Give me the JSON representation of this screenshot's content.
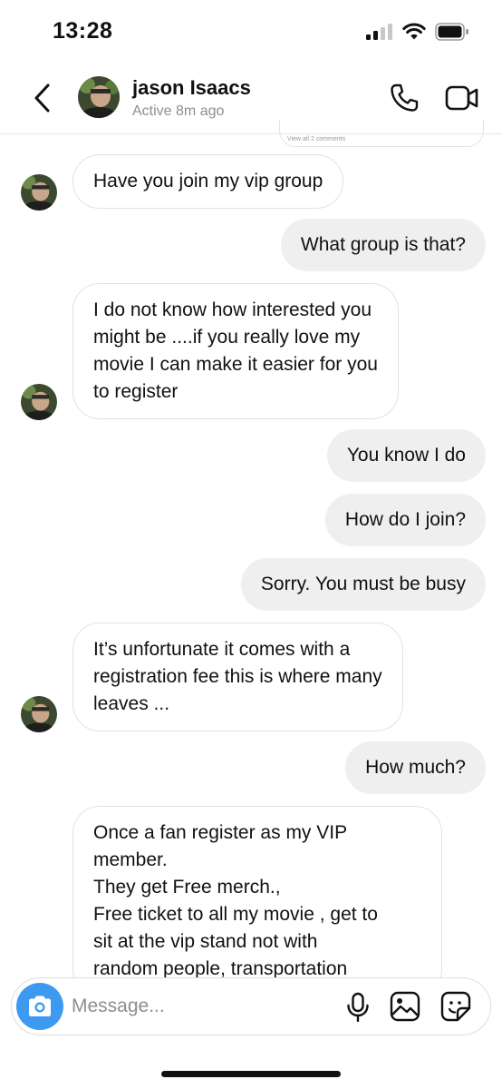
{
  "status_bar": {
    "time": "13:28"
  },
  "header": {
    "contact_name": "jason Isaacs",
    "contact_status": "Active 8m ago"
  },
  "shared_post": {
    "caption": "View all 2 comments"
  },
  "messages": [
    {
      "direction": "in",
      "lines": [
        "Have you join my vip group"
      ]
    },
    {
      "direction": "out",
      "lines": [
        "What group is that?"
      ]
    },
    {
      "direction": "in",
      "lines": [
        "I do not know how interested you",
        "might be ....if you really love my",
        "movie I can make it easier for you",
        "to register"
      ]
    },
    {
      "direction": "out",
      "lines": [
        "You know I do"
      ]
    },
    {
      "direction": "out",
      "lines": [
        "How do I join?"
      ]
    },
    {
      "direction": "out",
      "lines": [
        "Sorry.  You must be busy"
      ]
    },
    {
      "direction": "in",
      "lines": [
        "It’s unfortunate it comes with a",
        "registration fee this is where many",
        "leaves ..."
      ]
    },
    {
      "direction": "out",
      "lines": [
        "How much?"
      ]
    },
    {
      "direction": "in",
      "lines": [
        "Once a fan register as my VIP",
        "member.",
        "They get Free merch.,",
        "Free ticket to all my movie , get to",
        "sit at the vip stand not with",
        "random people, transportation"
      ]
    }
  ],
  "composer": {
    "placeholder": "Message..."
  },
  "icons": {
    "back": "chevron-left-icon",
    "call": "phone-icon",
    "video": "video-camera-icon",
    "camera": "camera-icon",
    "mic": "microphone-icon",
    "gallery": "image-icon",
    "sticker": "sticker-icon"
  },
  "colors": {
    "outgoing_bubble": "#efefef",
    "incoming_border": "#e2e2e2",
    "camera_button": "#3d9af0",
    "secondary_text": "#8e8e8e"
  }
}
